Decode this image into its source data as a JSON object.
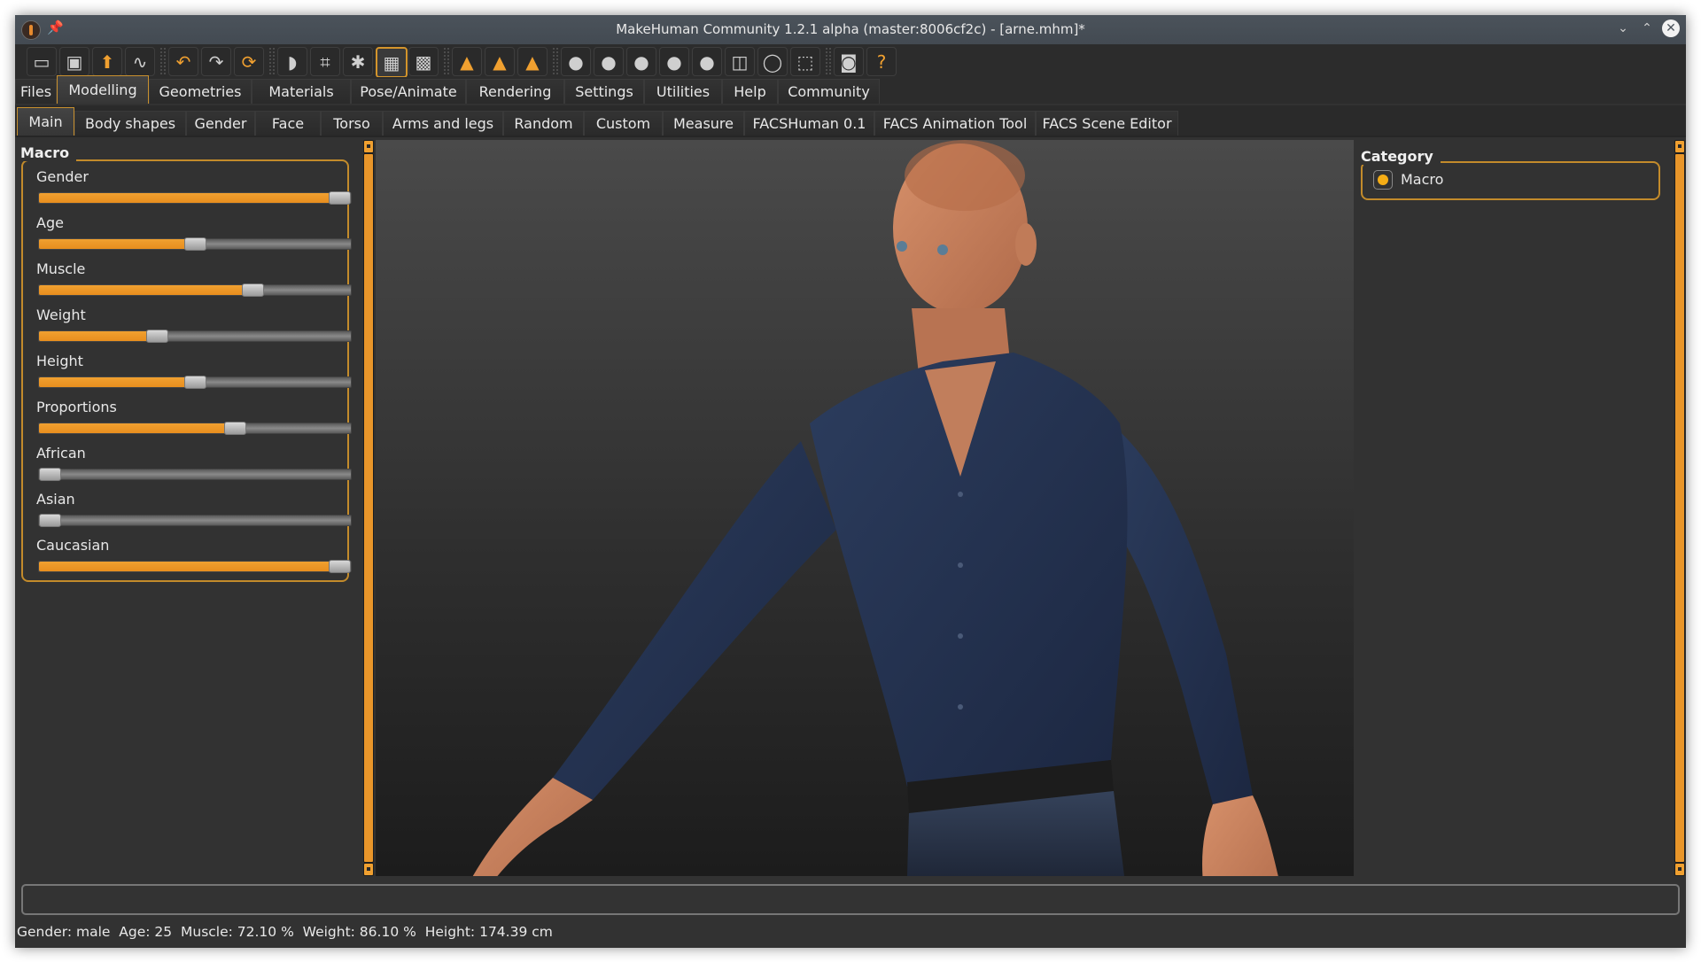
{
  "window": {
    "title": "MakeHuman Community 1.2.1 alpha (master:8006cf2c) - [arne.mhm]*",
    "controls": {
      "minimize": "⌄",
      "maximize": "⌃",
      "close": "✕"
    }
  },
  "toolbar": {
    "buttons": [
      {
        "name": "new-file",
        "icon": "▭"
      },
      {
        "name": "save",
        "icon": "▣"
      },
      {
        "name": "load",
        "icon": "⬆"
      },
      {
        "name": "export",
        "icon": "∿"
      },
      {
        "name": "undo",
        "icon": "↶"
      },
      {
        "name": "redo",
        "icon": "↷"
      },
      {
        "name": "reset",
        "icon": "⟳"
      },
      {
        "name": "smooth",
        "icon": "◗"
      },
      {
        "name": "wireframe",
        "icon": "⌗"
      },
      {
        "name": "pose",
        "icon": "✱"
      },
      {
        "name": "grid",
        "icon": "▦"
      },
      {
        "name": "background",
        "icon": "▩"
      },
      {
        "name": "symmetry-right",
        "icon": "▲"
      },
      {
        "name": "symmetry-left",
        "icon": "▲"
      },
      {
        "name": "symmetry-both",
        "icon": "▲"
      },
      {
        "name": "front-view",
        "icon": "●"
      },
      {
        "name": "back-view",
        "icon": "●"
      },
      {
        "name": "left-view",
        "icon": "●"
      },
      {
        "name": "right-view",
        "icon": "●"
      },
      {
        "name": "top-view",
        "icon": "●"
      },
      {
        "name": "bottom-view",
        "icon": "◫"
      },
      {
        "name": "reset-camera",
        "icon": "◯"
      },
      {
        "name": "ortho-view",
        "icon": "⬚"
      },
      {
        "name": "screenshot",
        "icon": "◙"
      },
      {
        "name": "help",
        "icon": "?"
      }
    ]
  },
  "main_tabs": [
    "Files",
    "Modelling",
    "Geometries",
    "Materials",
    "Pose/Animate",
    "Rendering",
    "Settings",
    "Utilities",
    "Help",
    "Community"
  ],
  "main_tab_active": "Modelling",
  "sub_tabs": [
    "Main",
    "Body shapes",
    "Gender",
    "Face",
    "Torso",
    "Arms and legs",
    "Random",
    "Custom",
    "Measure",
    "FACSHuman 0.1",
    "FACS Animation Tool",
    "FACS Scene Editor"
  ],
  "sub_tab_active": "Main",
  "left_panel": {
    "group_title": "Macro",
    "sliders": [
      {
        "label": "Gender",
        "value": 1.0
      },
      {
        "label": "Age",
        "value": 0.5
      },
      {
        "label": "Muscle",
        "value": 0.7
      },
      {
        "label": "Weight",
        "value": 0.37
      },
      {
        "label": "Height",
        "value": 0.5
      },
      {
        "label": "Proportions",
        "value": 0.64
      },
      {
        "label": "African",
        "value": 0.0
      },
      {
        "label": "Asian",
        "value": 0.0
      },
      {
        "label": "Caucasian",
        "value": 1.0
      }
    ]
  },
  "right_panel": {
    "group_title": "Category",
    "options": [
      {
        "label": "Macro",
        "selected": true
      }
    ]
  },
  "command_input": {
    "value": "",
    "placeholder": ""
  },
  "status_bar": "Gender: male  Age: 25  Muscle: 72.10 %  Weight: 86.10 %  Height: 174.39 cm",
  "colors": {
    "accent": "#f0a030",
    "background": "#323232",
    "titlebar": "#475058"
  }
}
